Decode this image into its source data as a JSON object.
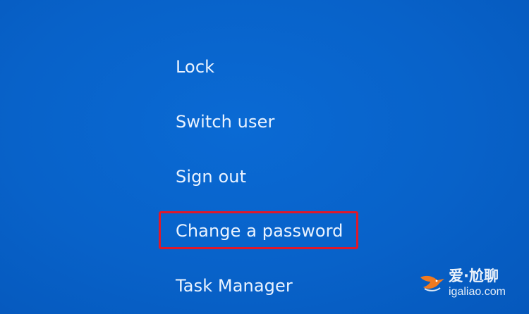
{
  "menu": {
    "items": [
      {
        "label": "Lock"
      },
      {
        "label": "Switch user"
      },
      {
        "label": "Sign out"
      },
      {
        "label": "Change a password"
      },
      {
        "label": "Task Manager"
      }
    ]
  },
  "highlight": {
    "target": "Change a password",
    "color": "#e0182a"
  },
  "watermark": {
    "cn_text": "爱·尬聊",
    "url_text": "igaliao.com"
  },
  "colors": {
    "background": "#0862c9",
    "text": "#eaf3ff"
  }
}
